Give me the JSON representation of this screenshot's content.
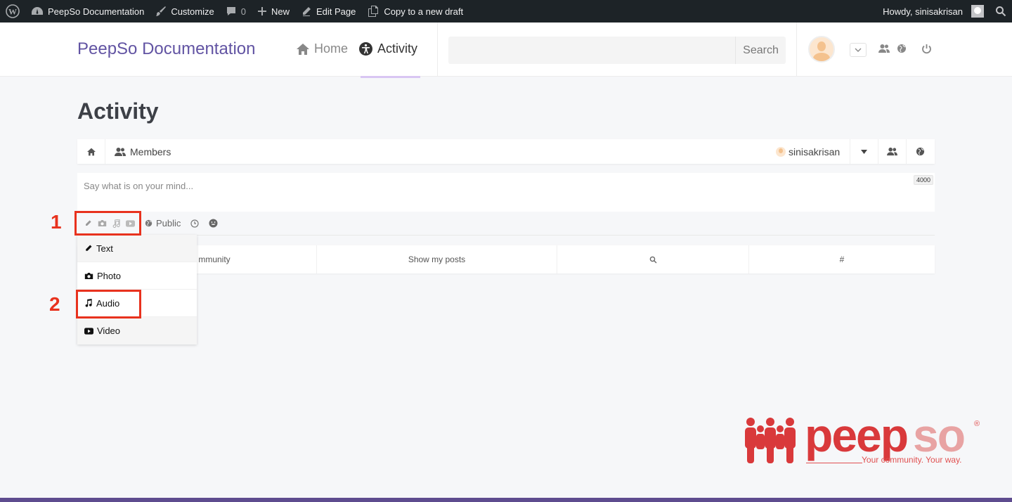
{
  "adminbar": {
    "site_name": "PeepSo Documentation",
    "customize": "Customize",
    "comments_count": "0",
    "new": "New",
    "edit_page": "Edit Page",
    "copy_draft": "Copy to a new draft",
    "howdy": "Howdy, sinisakrisan"
  },
  "header": {
    "site_title": "PeepSo Documentation",
    "nav": [
      {
        "label": "Home",
        "icon": "home-icon"
      },
      {
        "label": "Activity",
        "icon": "accessibility-icon",
        "active": true
      }
    ],
    "search_button": "Search"
  },
  "page": {
    "title": "Activity"
  },
  "ps_nav": {
    "members": "Members",
    "username": "sinisakrisan"
  },
  "postbox": {
    "placeholder": "Say what is on your mind...",
    "char_counter": "4000",
    "privacy": "Public"
  },
  "post_type_menu": {
    "items": [
      {
        "label": "Text",
        "icon": "pencil-icon"
      },
      {
        "label": "Photo",
        "icon": "camera-icon"
      },
      {
        "label": "Audio",
        "icon": "music-note-icon"
      },
      {
        "label": "Video",
        "icon": "youtube-icon"
      }
    ]
  },
  "filters": {
    "community_partial": "mmunity",
    "show_my_posts": "Show my posts",
    "hashtag": "#"
  },
  "annotations": {
    "step1": "1",
    "step2": "2"
  },
  "brand": {
    "logo_text": "peepso",
    "registered": "®",
    "tagline": "Your community. Your way.",
    "primary_color": "#6254a3",
    "accent_red": "#e8321e"
  }
}
